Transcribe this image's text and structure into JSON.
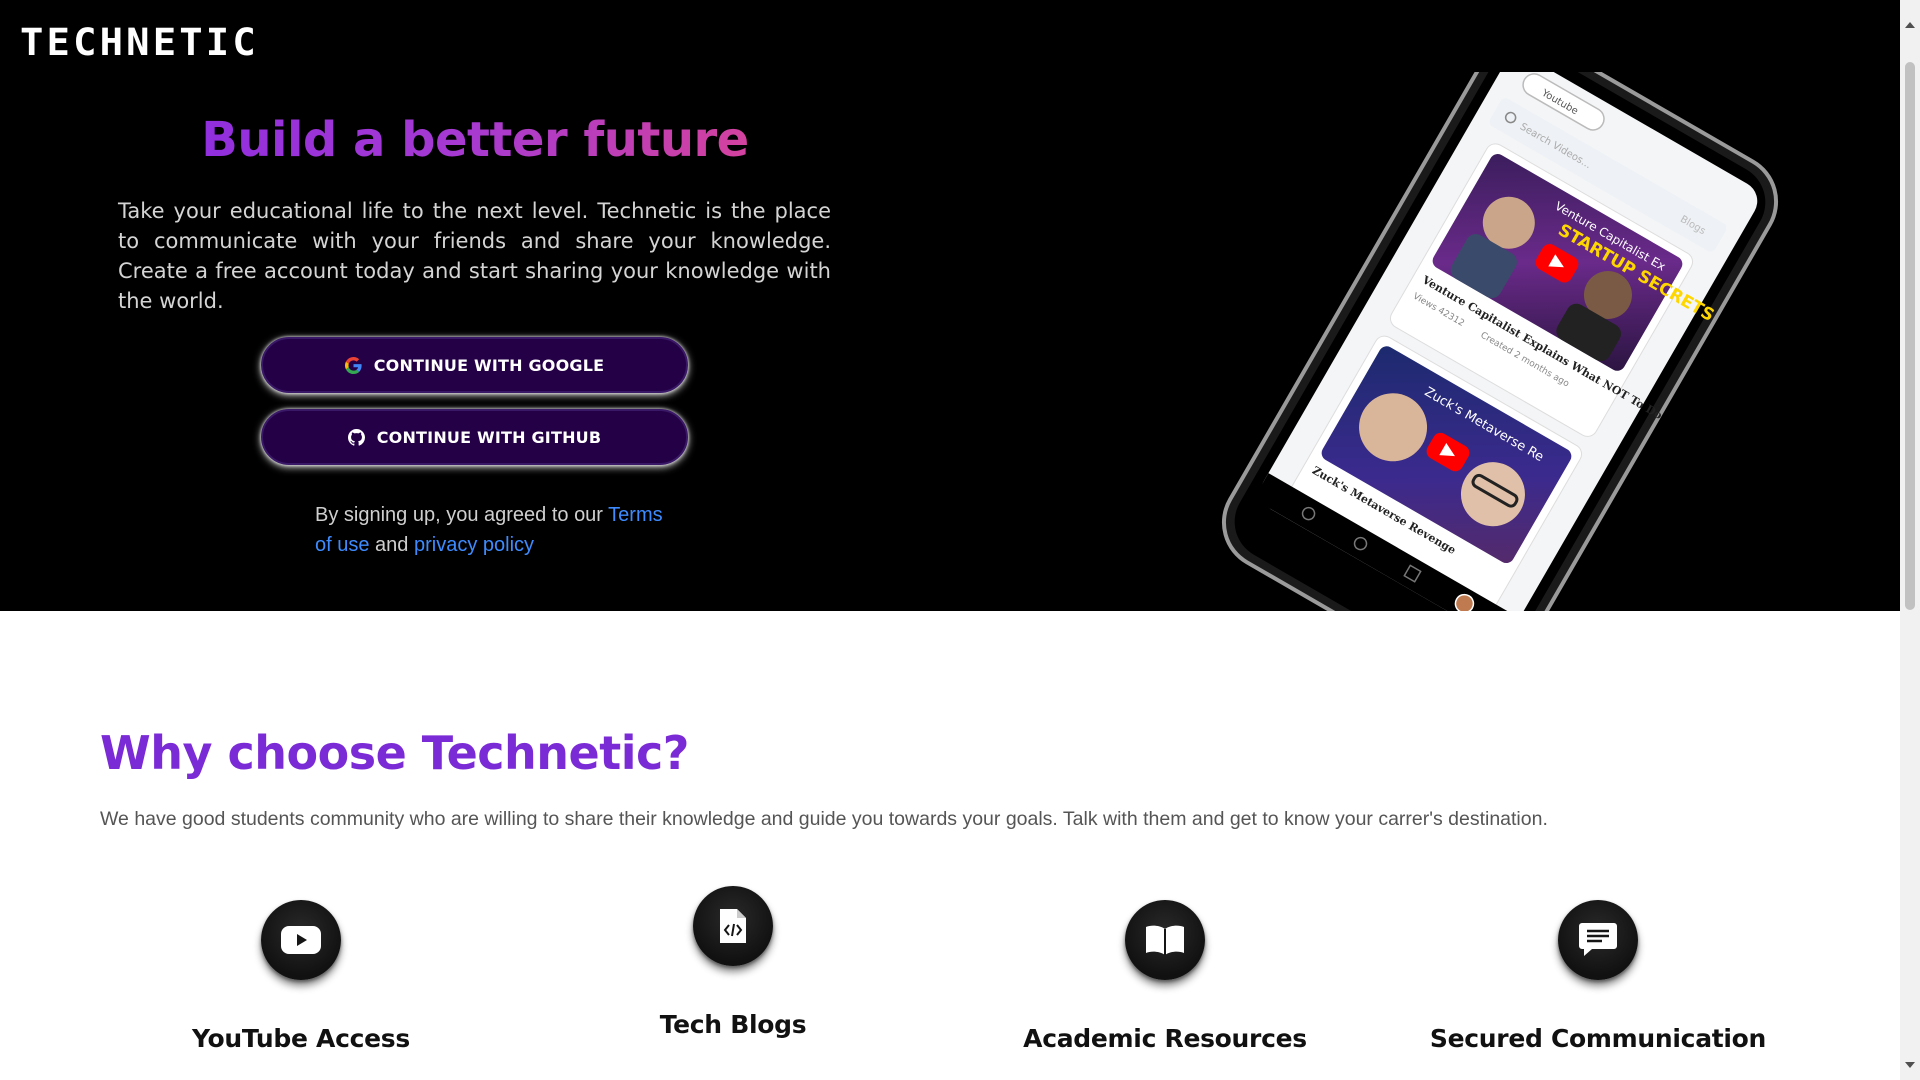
{
  "brand": {
    "logo_text": "TECHNETIC"
  },
  "hero": {
    "title": "Build a better future",
    "description": "Take your educational life to the next level. Technetic is the place to communicate with your friends and share your knowledge. Create a free account today and start sharing your knowledge with the world.",
    "google_button": "CONTINUE WITH GOOGLE",
    "github_button": "CONTINUE WITH GITHUB",
    "terms_prefix": "By signing up, you agreed to our",
    "terms_link": "Terms of use",
    "terms_and": "and",
    "privacy_link": "privacy policy"
  },
  "phone": {
    "app_label": "Youtube",
    "search_placeholder": "Search Videos...",
    "blogs_tab": "Blogs",
    "video1": {
      "thumb_text_1": "Venture Capitalist Ex",
      "thumb_text_2": "STARTUP SECRETS",
      "title": "Venture Capitalist Explains What NOT To Do",
      "views": "Views 42312",
      "created": "Created 2 months ago"
    },
    "video2": {
      "thumb_text": "Zuck's Metaverse Re",
      "title": "Zuck's Metaverse Revenge"
    }
  },
  "why": {
    "title": "Why choose Technetic?",
    "description": "We have good students community who are willing to share their knowledge and guide you towards your goals. Talk with them and get to know your carrer's destination.",
    "features": [
      {
        "label": "YouTube Access",
        "icon": "youtube-icon"
      },
      {
        "label": "Tech Blogs",
        "icon": "code-file-icon"
      },
      {
        "label": "Academic Resources",
        "icon": "book-icon"
      },
      {
        "label": "Secured Communication",
        "icon": "chat-icon"
      }
    ]
  },
  "colors": {
    "accent_purple": "#7b2bd6",
    "gradient_start": "#8a2be2",
    "gradient_end": "#e0448f",
    "button_bg": "#240046",
    "link_blue": "#3d8bff"
  }
}
